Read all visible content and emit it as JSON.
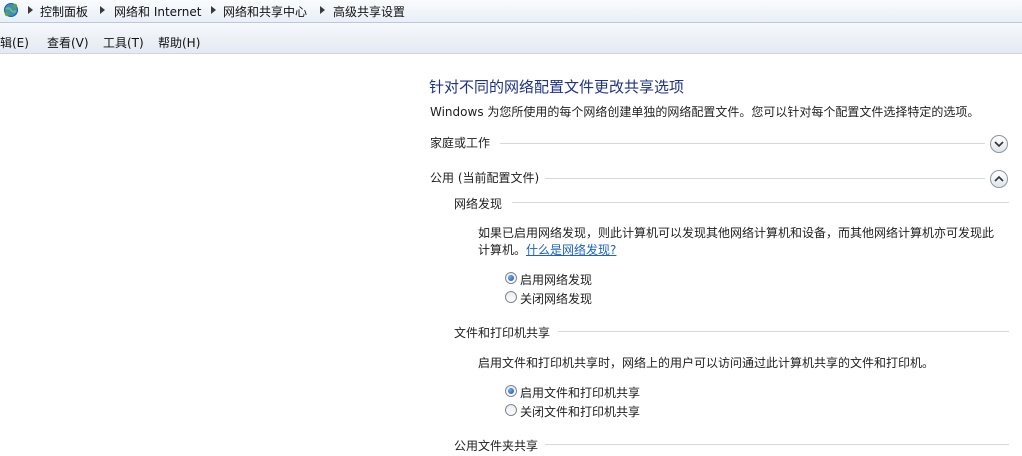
{
  "breadcrumb": {
    "items": [
      "控制面板",
      "网络和 Internet",
      "网络和共享中心",
      "高级共享设置"
    ]
  },
  "menu": {
    "items": [
      "辑(E)",
      "查看(V)",
      "工具(T)",
      "帮助(H)"
    ]
  },
  "content": {
    "title": "针对不同的网络配置文件更改共享选项",
    "description": "Windows 为您所使用的每个网络创建单独的网络配置文件。您可以针对每个配置文件选择特定的选项。",
    "profiles": [
      {
        "label": "家庭或工作",
        "state": "collapsed"
      },
      {
        "label": "公用 (当前配置文件)",
        "state": "expanded"
      }
    ],
    "network_discovery": {
      "heading": "网络发现",
      "text_line1": "如果已启用网络发现，则此计算机可以发现其他网络计算机和设备，而其他网络计算机亦可发现此",
      "text_line2": "计算机。",
      "link": "什么是网络发现?",
      "options": [
        {
          "label": "启用网络发现",
          "checked": true
        },
        {
          "label": "关闭网络发现",
          "checked": false
        }
      ]
    },
    "file_printer_sharing": {
      "heading": "文件和打印机共享",
      "text": "启用文件和打印机共享时，网络上的用户可以访问通过此计算机共享的文件和打印机。",
      "options": [
        {
          "label": "启用文件和打印机共享",
          "checked": true
        },
        {
          "label": "关闭文件和打印机共享",
          "checked": false
        }
      ]
    },
    "public_folder_sharing": {
      "heading": "公用文件夹共享"
    }
  },
  "colors": {
    "title": "#1e3287",
    "link": "#1a62c8",
    "radio_selected": "#1a4fb0"
  }
}
